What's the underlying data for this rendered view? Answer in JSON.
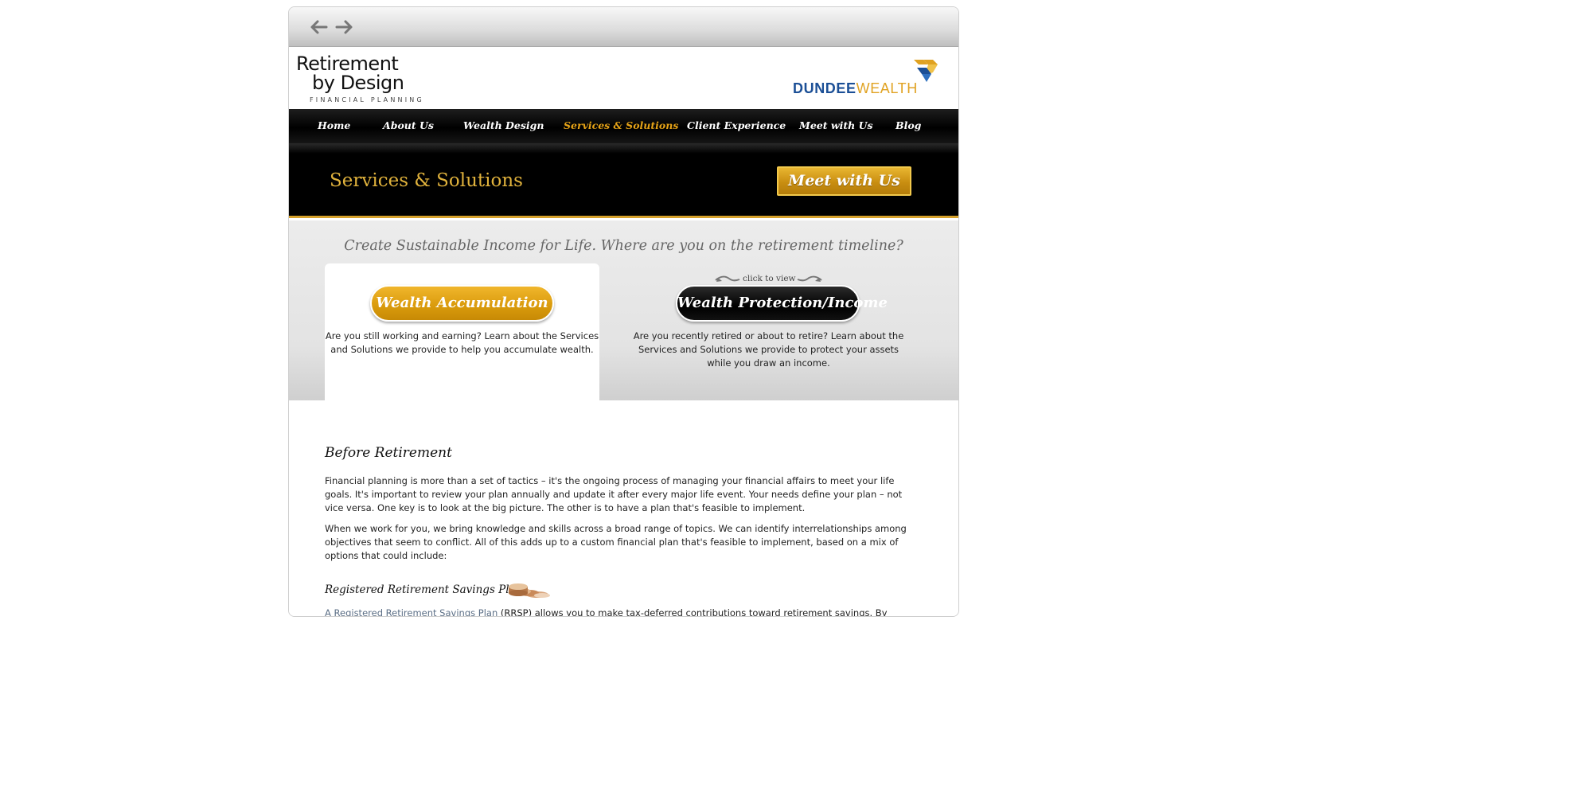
{
  "browser": {
    "back_icon": "back-arrow-icon",
    "forward_icon": "forward-arrow-icon"
  },
  "header": {
    "brand_line1": "Retirement",
    "brand_line2": "by Design",
    "brand_sub": "FINANCIAL PLANNING",
    "partner_part1": "DUNDEE",
    "partner_part2": "WEALTH",
    "colors": {
      "partner_blue": "#1b4f96",
      "partner_gold": "#e0a221"
    }
  },
  "nav": {
    "items": [
      {
        "label": "Home"
      },
      {
        "label": "About Us"
      },
      {
        "label": "Wealth Design"
      },
      {
        "label": "Services & Solutions",
        "active": true
      },
      {
        "label": "Client Experience"
      },
      {
        "label": "Meet with Us"
      },
      {
        "label": "Blog"
      }
    ],
    "colors": {
      "text": "#ffffff",
      "active": "#e6a317",
      "background": "#000000"
    }
  },
  "banner": {
    "title": "Services & Solutions",
    "cta_label": "Meet with Us"
  },
  "timeline": {
    "heading": "Create Sustainable Income for Life.  Where are you on the retirement timeline?",
    "click_hint": "click to view",
    "left": {
      "button_label": "Wealth Accumulation",
      "line1": "Are you still working and earning? Learn about the Services",
      "line2": "and Solutions we provide to help you accumulate wealth."
    },
    "right": {
      "button_label": "Wealth Protection/Income",
      "line1": "Are you recently retired or about to retire? Learn about the",
      "line2": "Services and Solutions we provide to protect your assets",
      "line3": "while you draw an income."
    }
  },
  "content": {
    "section_title": "Before Retirement",
    "para1": "Financial planning is more than a set of tactics – it's the ongoing process of managing your financial affairs to meet your life goals. It's important to review your plan annually and update it after every major life event. Your needs define your plan – not vice versa. One key is to look at the big picture. The other is to have a plan that's feasible to implement.",
    "para2": "When we work for you, we bring knowledge and skills across a broad range of topics. We can identify interrelationships among objectives that seem to conflict. All of this adds up to a custom financial plan that's feasible to implement, based on a mix of options that could include:",
    "sub_title": "Registered Retirement Savings Plans",
    "coins_icon": "coins-icon",
    "para3_link": "A Registered Retirement Savings Plan",
    "para3_rest": " (RRSP) allows you to make tax-deferred contributions toward retirement savings. By deferring taxes"
  }
}
